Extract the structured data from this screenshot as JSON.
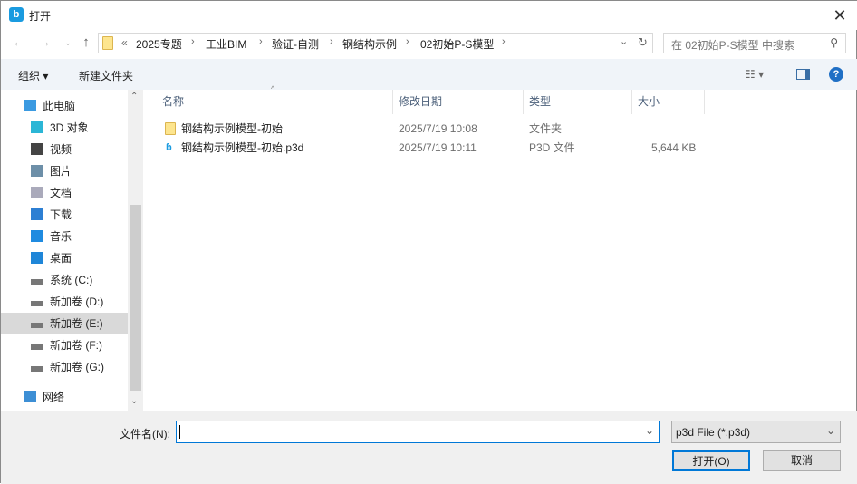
{
  "window": {
    "title": "打开",
    "close": "✕"
  },
  "address": {
    "prefix": "«",
    "crumbs": [
      "2025专题",
      "工业BIM",
      "验证-自测",
      "钢结构示例",
      "02初始P-S模型"
    ],
    "search_placeholder": "在 02初始P-S模型 中搜索"
  },
  "toolbar": {
    "organize": "组织 ▾",
    "new_folder": "新建文件夹"
  },
  "sidebar": {
    "items": [
      {
        "label": "此电脑",
        "icon": "computer-icon"
      },
      {
        "label": "3D 对象",
        "icon": "cube-icon"
      },
      {
        "label": "视频",
        "icon": "video-icon"
      },
      {
        "label": "图片",
        "icon": "picture-icon"
      },
      {
        "label": "文档",
        "icon": "document-icon"
      },
      {
        "label": "下载",
        "icon": "download-icon"
      },
      {
        "label": "音乐",
        "icon": "music-icon"
      },
      {
        "label": "桌面",
        "icon": "desktop-icon"
      },
      {
        "label": "系统 (C:)",
        "icon": "drive-icon"
      },
      {
        "label": "新加卷 (D:)",
        "icon": "drive-icon"
      },
      {
        "label": "新加卷 (E:)",
        "icon": "drive-icon",
        "selected": true
      },
      {
        "label": "新加卷 (F:)",
        "icon": "drive-icon"
      },
      {
        "label": "新加卷 (G:)",
        "icon": "drive-icon"
      },
      {
        "label": "网络",
        "icon": "network-icon"
      }
    ]
  },
  "columns": [
    "名称",
    "修改日期",
    "类型",
    "大小"
  ],
  "files": [
    {
      "name": "钢结构示例模型-初始",
      "date": "2025/7/19 10:08",
      "type": "文件夹",
      "size": ""
    },
    {
      "name": "钢结构示例模型-初始.p3d",
      "date": "2025/7/19 10:11",
      "type": "P3D 文件",
      "size": "5,644 KB"
    }
  ],
  "footer": {
    "filename_label": "文件名(N):",
    "filename_value": "",
    "filter": "p3d File (*.p3d)",
    "open": "打开(O)",
    "cancel": "取消"
  }
}
